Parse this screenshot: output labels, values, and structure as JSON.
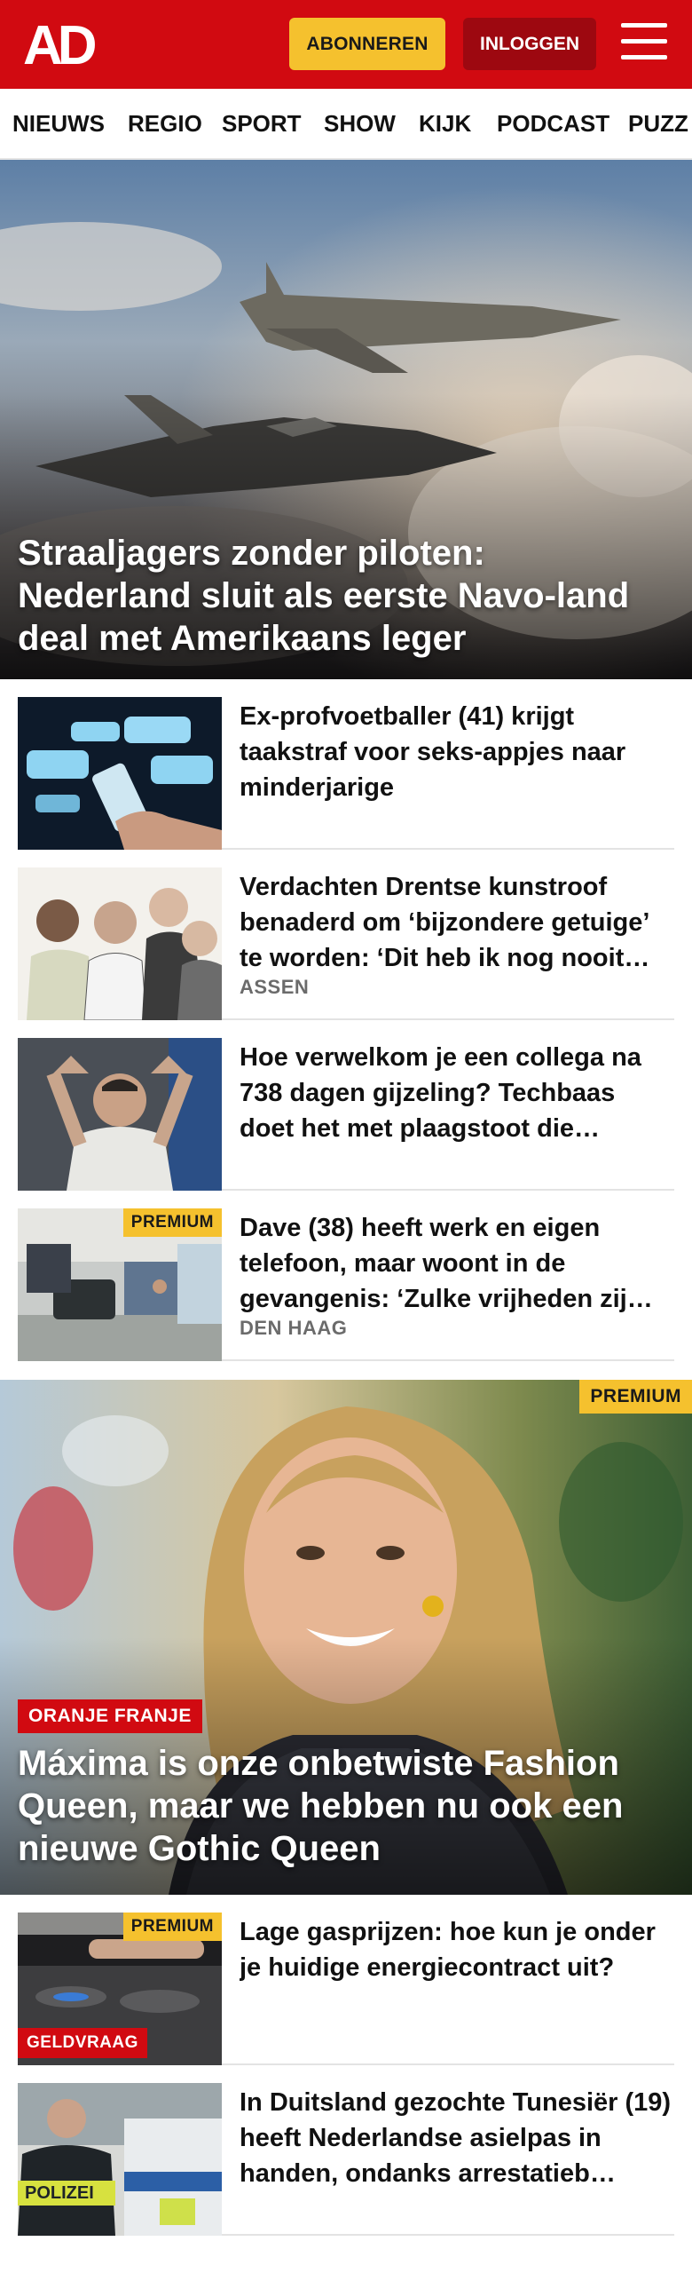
{
  "header": {
    "logo_text": "AD",
    "subscribe_label": "ABONNEREN",
    "login_label": "INLOGGEN",
    "menu_icon": "hamburger-menu-icon",
    "brand_color": "#d10a11",
    "accent_color": "#f5c12e"
  },
  "nav": {
    "items": [
      "NIEUWS",
      "REGIO",
      "SPORT",
      "SHOW",
      "KIJK",
      "PODCAST",
      "PUZZ"
    ]
  },
  "hero": {
    "title": "Straaljagers zonder piloten: Nederland sluit als eerste Navo-land deal met Amerikaans leger"
  },
  "articles": [
    {
      "title": "Ex-profvoetballer (41) krijgt taakstraf voor seks-appjes naar minderjarige",
      "tag": "",
      "premium": ""
    },
    {
      "title": "Verdachten Drentse kunstroof benaderd om ‘bijzondere getuige’ te worden: ‘Dit heb ik nog nooit…",
      "tag": "ASSEN",
      "premium": ""
    },
    {
      "title": "Hoe verwelkom je een collega na 738 dagen gijzeling? Techbaas doet het met plaagstoot die…",
      "tag": "",
      "premium": ""
    },
    {
      "title": "Dave (38) heeft werk en eigen telefoon, maar woont in de gevangenis: ‘Zulke vrijheden zij…",
      "tag": "DEN HAAG",
      "premium": "PREMIUM"
    }
  ],
  "feature": {
    "premium": "PREMIUM",
    "label": "ORANJE FRANJE",
    "title": "Máxima is onze onbetwiste Fashion Queen, maar we hebben nu ook een nieuwe Gothic Queen"
  },
  "articles2": [
    {
      "title": "Lage gasprijzen: hoe kun je onder je huidige energiecontract uit?",
      "premium": "PREMIUM",
      "label": "GELDVRAAG"
    },
    {
      "title": "In Duitsland gezochte Tunesiër (19) heeft Nederlandse asielpas in handen, ondanks arrestatieb…",
      "premium": "",
      "label": "",
      "badge": "POLIZEI"
    }
  ]
}
